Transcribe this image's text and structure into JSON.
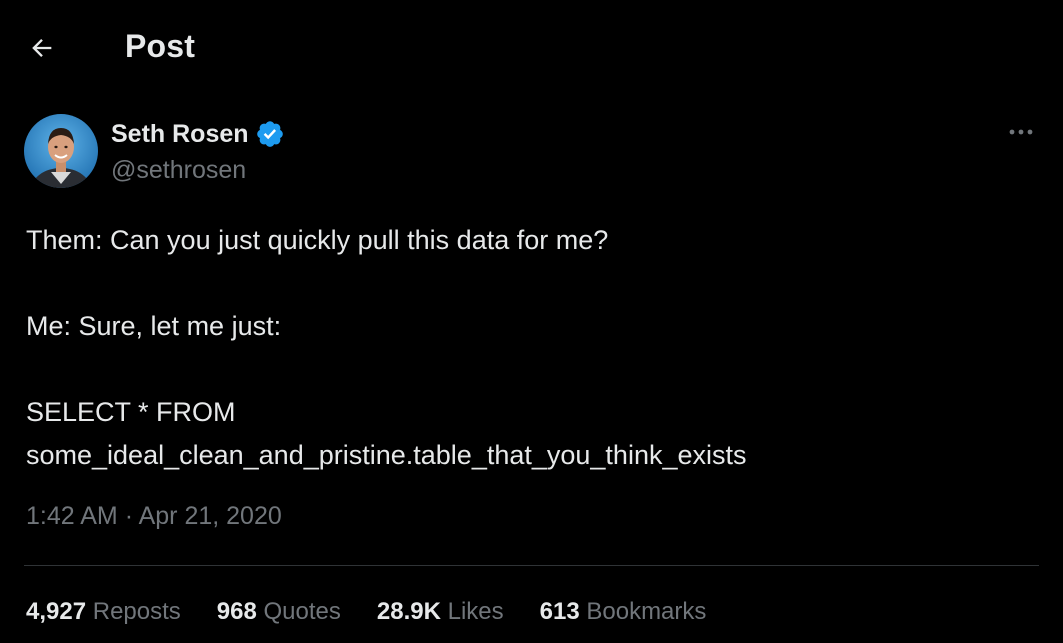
{
  "header": {
    "back_icon": "arrow-left-icon",
    "title": "Post"
  },
  "author": {
    "display_name": "Seth Rosen",
    "handle": "@sethrosen",
    "verified": true,
    "verified_color": "#1d9bf0",
    "more_icon": "more-horizontal-icon"
  },
  "post": {
    "lines": [
      "Them: Can you just quickly pull this data for me?",
      "Me: Sure, let me just:",
      "SELECT * FROM",
      "some_ideal_clean_and_pristine.table_that_you_think_exists"
    ],
    "time": "1:42 AM",
    "separator": "·",
    "date": "Apr 21, 2020"
  },
  "stats": {
    "reposts_count": "4,927",
    "reposts_label": "Reposts",
    "quotes_count": "968",
    "quotes_label": "Quotes",
    "likes_count": "28.9K",
    "likes_label": "Likes",
    "bookmarks_count": "613",
    "bookmarks_label": "Bookmarks"
  },
  "colors": {
    "background": "#000000",
    "primary_text": "#e7e9ea",
    "secondary_text": "#71767b",
    "divider": "#2f3336"
  }
}
